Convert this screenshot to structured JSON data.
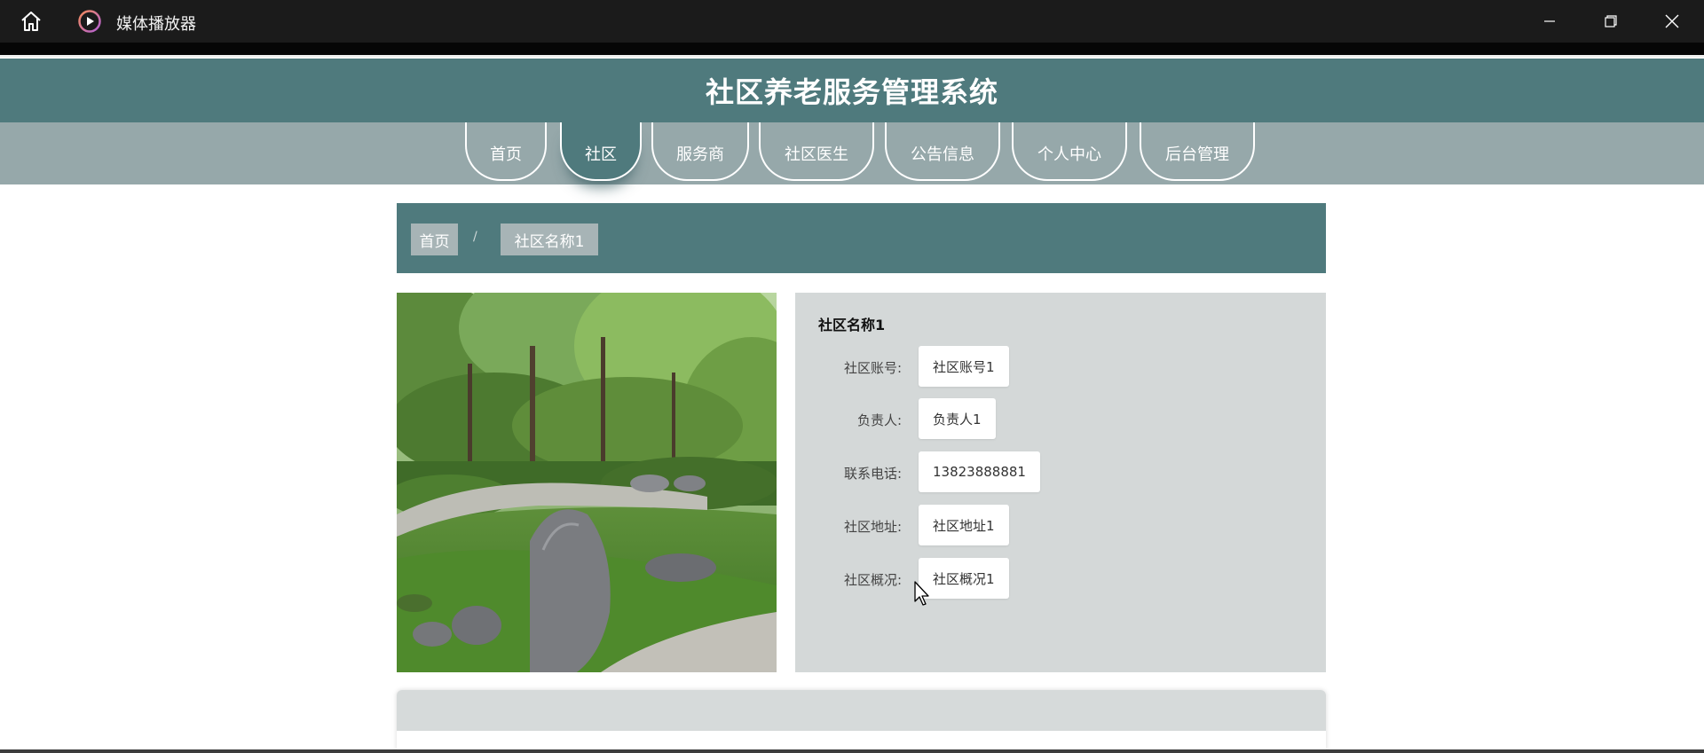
{
  "window": {
    "title": "媒体播放器",
    "home_icon": "home-icon",
    "app_icon": "play-icon"
  },
  "site": {
    "title": "社区养老服务管理系统"
  },
  "nav": {
    "items": [
      {
        "label": "首页",
        "active": false
      },
      {
        "label": "社区",
        "active": true
      },
      {
        "label": "服务商",
        "active": false
      },
      {
        "label": "社区医生",
        "active": false
      },
      {
        "label": "公告信息",
        "active": false
      },
      {
        "label": "个人中心",
        "active": false
      },
      {
        "label": "后台管理",
        "active": false
      }
    ]
  },
  "breadcrumb": {
    "home": "首页",
    "separator": "/",
    "current": "社区名称1"
  },
  "detail": {
    "title": "社区名称1",
    "rows": [
      {
        "label": "社区账号:",
        "value": "社区账号1"
      },
      {
        "label": "负责人:",
        "value": "负责人1"
      },
      {
        "label": "联系电话:",
        "value": "13823888881"
      },
      {
        "label": "社区地址:",
        "value": "社区地址1"
      },
      {
        "label": "社区概况:",
        "value": "社区概况1"
      }
    ]
  },
  "colors": {
    "header": "#4f7a7d",
    "nav_band": "#96a8aa",
    "panel": "#d4d8d8"
  }
}
